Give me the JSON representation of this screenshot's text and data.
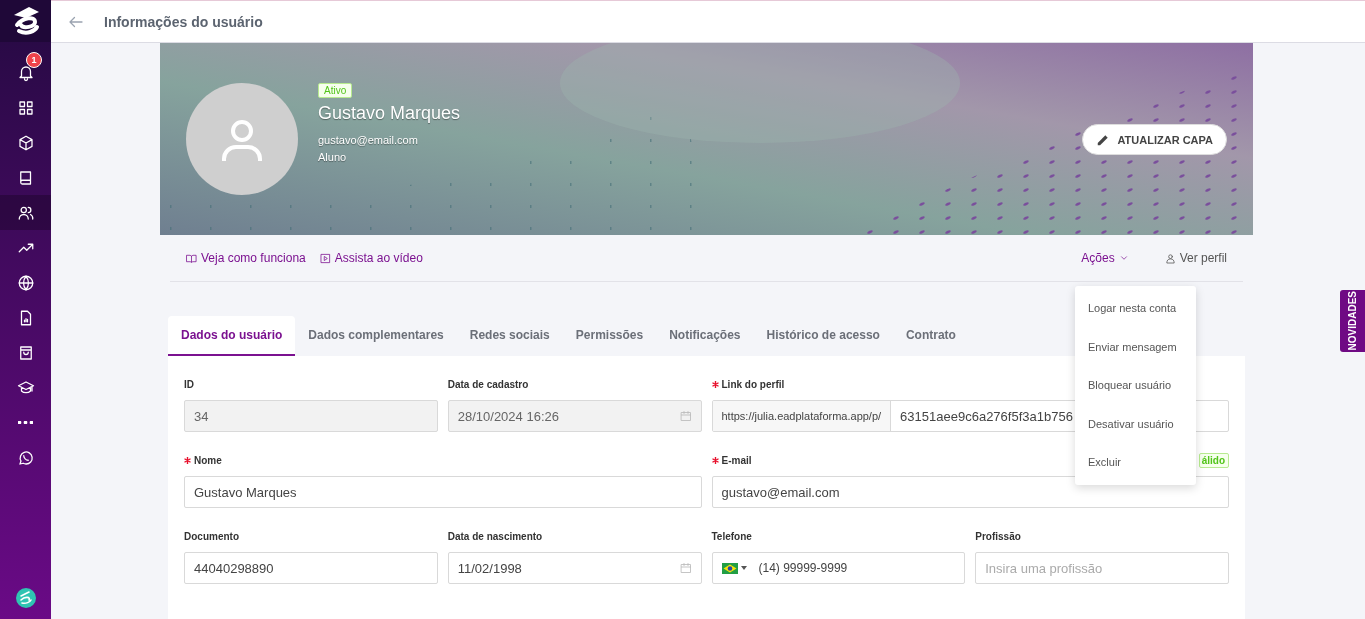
{
  "sidebar": {
    "items": [
      {
        "kind": "bell",
        "selected": false,
        "badge": "1"
      },
      {
        "kind": "grid",
        "selected": false
      },
      {
        "kind": "cube",
        "selected": false
      },
      {
        "kind": "book",
        "selected": false
      },
      {
        "kind": "users",
        "selected": true
      },
      {
        "kind": "trend",
        "selected": false
      },
      {
        "kind": "globe",
        "selected": false
      },
      {
        "kind": "report",
        "selected": false
      },
      {
        "kind": "bag",
        "selected": false
      },
      {
        "kind": "cap",
        "selected": false
      },
      {
        "kind": "more",
        "selected": false
      },
      {
        "kind": "chat",
        "selected": false
      }
    ]
  },
  "header": {
    "title": "Informações do usuário"
  },
  "profile": {
    "status": "Ativo",
    "name": "Gustavo Marques",
    "email": "gustavo@email.com",
    "role": "Aluno",
    "cover_button": "ATUALIZAR CAPA"
  },
  "help_links": [
    {
      "kind": "book",
      "label": "Veja como funciona"
    },
    {
      "kind": "video",
      "label": "Assista ao vídeo"
    }
  ],
  "actions": {
    "label": "Ações",
    "expanded": true,
    "menu": [
      "Logar nesta conta",
      "Enviar mensagem",
      "Bloquear usuário",
      "Desativar usuário",
      "Excluir"
    ]
  },
  "view_profile": "Ver perfil",
  "tabs": [
    {
      "label": "Dados do usuário",
      "selected": true
    },
    {
      "label": "Dados complementares",
      "selected": false
    },
    {
      "label": "Redes sociais",
      "selected": false
    },
    {
      "label": "Permissões",
      "selected": false
    },
    {
      "label": "Notificações",
      "selected": false
    },
    {
      "label": "Histórico de acesso",
      "selected": false
    },
    {
      "label": "Contrato",
      "selected": false
    }
  ],
  "form": {
    "fields": [
      {
        "kind": "text",
        "label": "ID",
        "required": false,
        "disabled": true,
        "value": "34"
      },
      {
        "kind": "date",
        "label": "Data de cadastro",
        "required": false,
        "disabled": true,
        "value": "28/10/2024 16:26"
      },
      {
        "kind": "link",
        "label": "Link do perfil",
        "required": true,
        "disabled": false,
        "prefix": "https://julia.eadplataforma.app/p/",
        "value": "63151aee9c6a276f5f3a1b756"
      },
      {
        "kind": "text",
        "label": "Nome",
        "required": true,
        "disabled": false,
        "value": "Gustavo Marques"
      },
      {
        "kind": "text",
        "label": "E-mail",
        "required": true,
        "disabled": false,
        "value": "gustavo@email.com",
        "badge": "álido"
      },
      {
        "kind": "text",
        "label": "Documento",
        "required": false,
        "disabled": false,
        "value": "44040298890"
      },
      {
        "kind": "date",
        "label": "Data de nascimento",
        "required": false,
        "disabled": false,
        "value": "11/02/1998"
      },
      {
        "kind": "phone",
        "label": "Telefone",
        "required": false,
        "disabled": false,
        "value": "(14) 99999-9999"
      },
      {
        "kind": "text",
        "label": "Profissão",
        "required": false,
        "disabled": false,
        "placeholder": "Insira uma profissão"
      }
    ]
  },
  "side_tab": "NOVIDADES"
}
